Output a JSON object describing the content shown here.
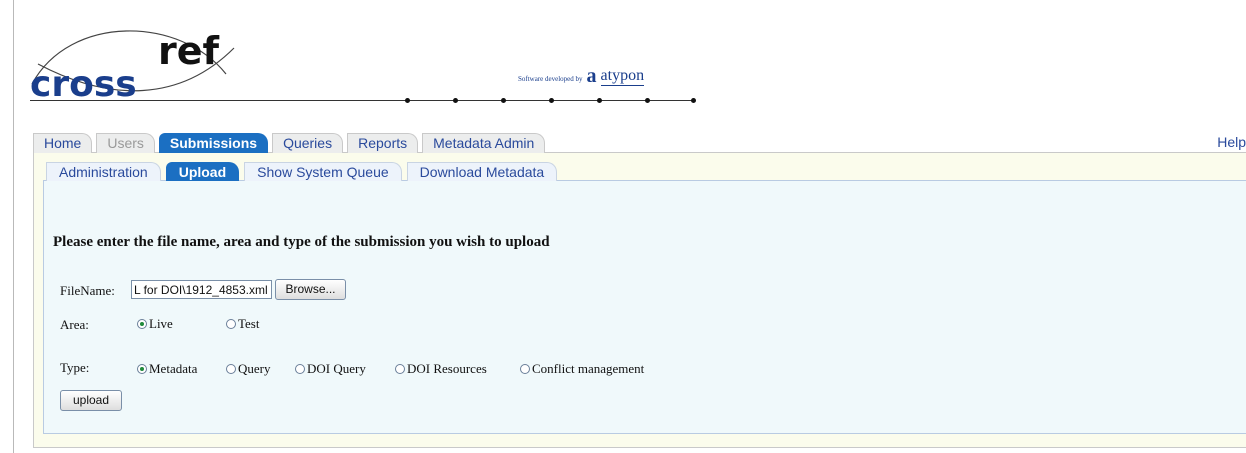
{
  "header": {
    "logo_text_left": "cross",
    "logo_text_right": "ref",
    "developer_prefix": "Software developed by",
    "developer_mark": "a",
    "developer_name": "atypon"
  },
  "main_tabs": [
    "Home",
    "Users",
    "Submissions",
    "Queries",
    "Reports",
    "Metadata Admin"
  ],
  "main_tab_state": [
    "normal",
    "disabled",
    "active",
    "normal",
    "normal",
    "normal"
  ],
  "help_label": "Help",
  "sub_tabs": [
    "Administration",
    "Upload",
    "Show System Queue",
    "Download Metadata"
  ],
  "active_sub_tab": "Upload",
  "form": {
    "instruction": "Please enter the file name, area and type of the submission you wish to upload",
    "filename_label": "FileName:",
    "filename_value": "L for DOI\\1912_4853.xml",
    "browse_label": "Browse...",
    "area_label": "Area:",
    "area_options": [
      "Live",
      "Test"
    ],
    "area_selected": "Live",
    "type_label": "Type:",
    "type_options": [
      "Metadata",
      "Query",
      "DOI Query",
      "DOI Resources",
      "Conflict management"
    ],
    "type_selected": "Metadata",
    "upload_label": "upload"
  },
  "colors": {
    "logo_blue": "#1a3e8c",
    "tab_active": "#1b6fc2",
    "panel_bg": "#f0f9fb"
  }
}
